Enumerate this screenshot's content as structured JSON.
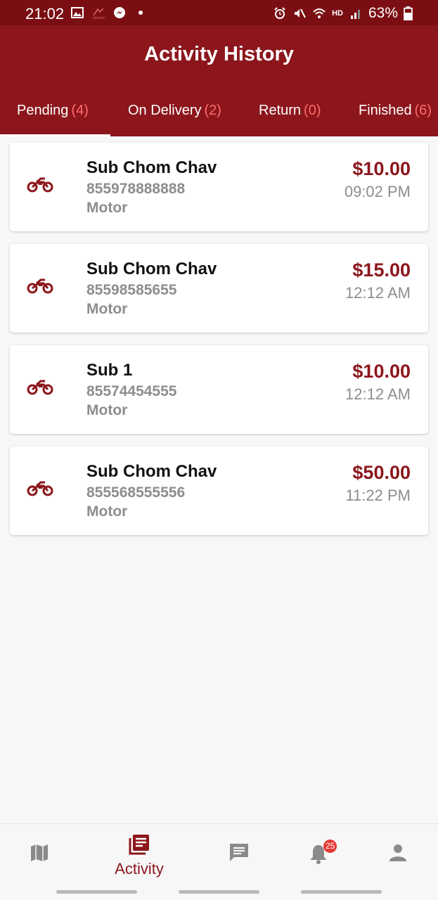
{
  "status_bar": {
    "time": "21:02",
    "battery": "63%",
    "icons_left": [
      "image-icon",
      "app-logo-icon",
      "messenger-icon",
      "dot-icon"
    ],
    "icons_right": [
      "alarm-icon",
      "mute-icon",
      "wifi-icon",
      "hd-icon",
      "signal-icon",
      "battery-icon"
    ],
    "hd_label": "HD"
  },
  "header": {
    "title": "Activity History",
    "color": "#8c161c"
  },
  "tabs": [
    {
      "label": "Pending",
      "count": "(4)",
      "active": true
    },
    {
      "label": "On Delivery",
      "count": "(2)",
      "active": false
    },
    {
      "label": "Return",
      "count": "(0)",
      "active": false
    },
    {
      "label": "Finished",
      "count": "(6)",
      "active": false
    }
  ],
  "orders": [
    {
      "name": "Sub Chom Chav",
      "phone": "855978888888",
      "type": "Motor",
      "price": "$10.00",
      "time": "09:02 PM",
      "icon": "motorcycle-icon"
    },
    {
      "name": "Sub Chom Chav",
      "phone": "85598585655",
      "type": "Motor",
      "price": "$15.00",
      "time": "12:12 AM",
      "icon": "motorcycle-icon"
    },
    {
      "name": "Sub 1",
      "phone": "85574454555",
      "type": "Motor",
      "price": "$10.00",
      "time": "12:12 AM",
      "icon": "motorcycle-icon"
    },
    {
      "name": "Sub Chom Chav",
      "phone": "855568555556",
      "type": "Motor",
      "price": "$50.00",
      "time": "11:22 PM",
      "icon": "motorcycle-icon"
    }
  ],
  "bottom_nav": {
    "items": [
      {
        "icon": "map-icon",
        "label": ""
      },
      {
        "icon": "activity-icon",
        "label": "Activity",
        "active": true
      },
      {
        "icon": "chat-icon",
        "label": ""
      },
      {
        "icon": "bell-icon",
        "label": "",
        "badge": "25"
      },
      {
        "icon": "profile-icon",
        "label": ""
      }
    ]
  }
}
